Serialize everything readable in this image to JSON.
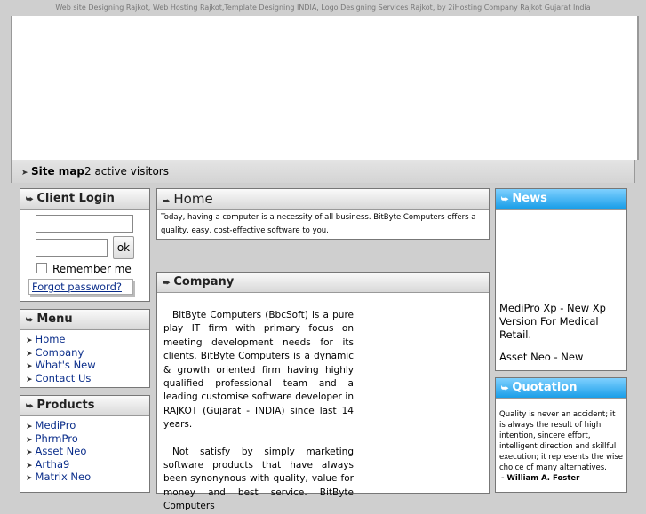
{
  "top_bar": {
    "text": "Web site Designing Rajkot, Web Hosting Rajkot,Template Designing INDIA, Logo Designing Services Rajkot, by 2iHosting Company Rajkot Gujarat India"
  },
  "site_bar": {
    "site_map": "Site map",
    "visitors": "2 active visitors"
  },
  "client_login": {
    "title": "Client Login",
    "username_value": "",
    "password_value": "",
    "ok_label": "ok",
    "remember_label": "Remember me",
    "forgot_label": "Forgot password?"
  },
  "menu": {
    "title": "Menu",
    "items": [
      "Home",
      "Company",
      "What's New",
      "Contact Us"
    ]
  },
  "products": {
    "title": "Products",
    "items": [
      "MediPro",
      "PhrmPro",
      "Asset Neo",
      "Artha9",
      "Matrix Neo"
    ]
  },
  "home": {
    "title": "Home",
    "text": "Today, having a computer is a necessity of all business. BitByte Computers offers a quality, easy, cost-effective software to you."
  },
  "company": {
    "title": "Company",
    "para1": "BitByte Computers (BbcSoft) is a pure play IT firm with primary focus on meeting development needs for its clients. BitByte Computers is a dynamic & growth oriented firm having highly qualified professional team and a leading customise software developer in RAJKOT (Gujarat - INDIA) since last 14 years.",
    "para2": "Not satisfy by simply marketing software products that have always been synonynous with quality, value for money and best service. BitByte Computers"
  },
  "news": {
    "title": "News",
    "item1": "MediPro Xp - New Xp Version For Medical Retail.",
    "item2": "Asset Neo - New"
  },
  "quotation": {
    "title": "Quotation",
    "text": "Quality is never an accident; it is always the result of high intention, sincere effort, intelligent direction and skillful execution; it represents the wise choice of many alternatives.",
    "author": "- William A. Foster"
  }
}
